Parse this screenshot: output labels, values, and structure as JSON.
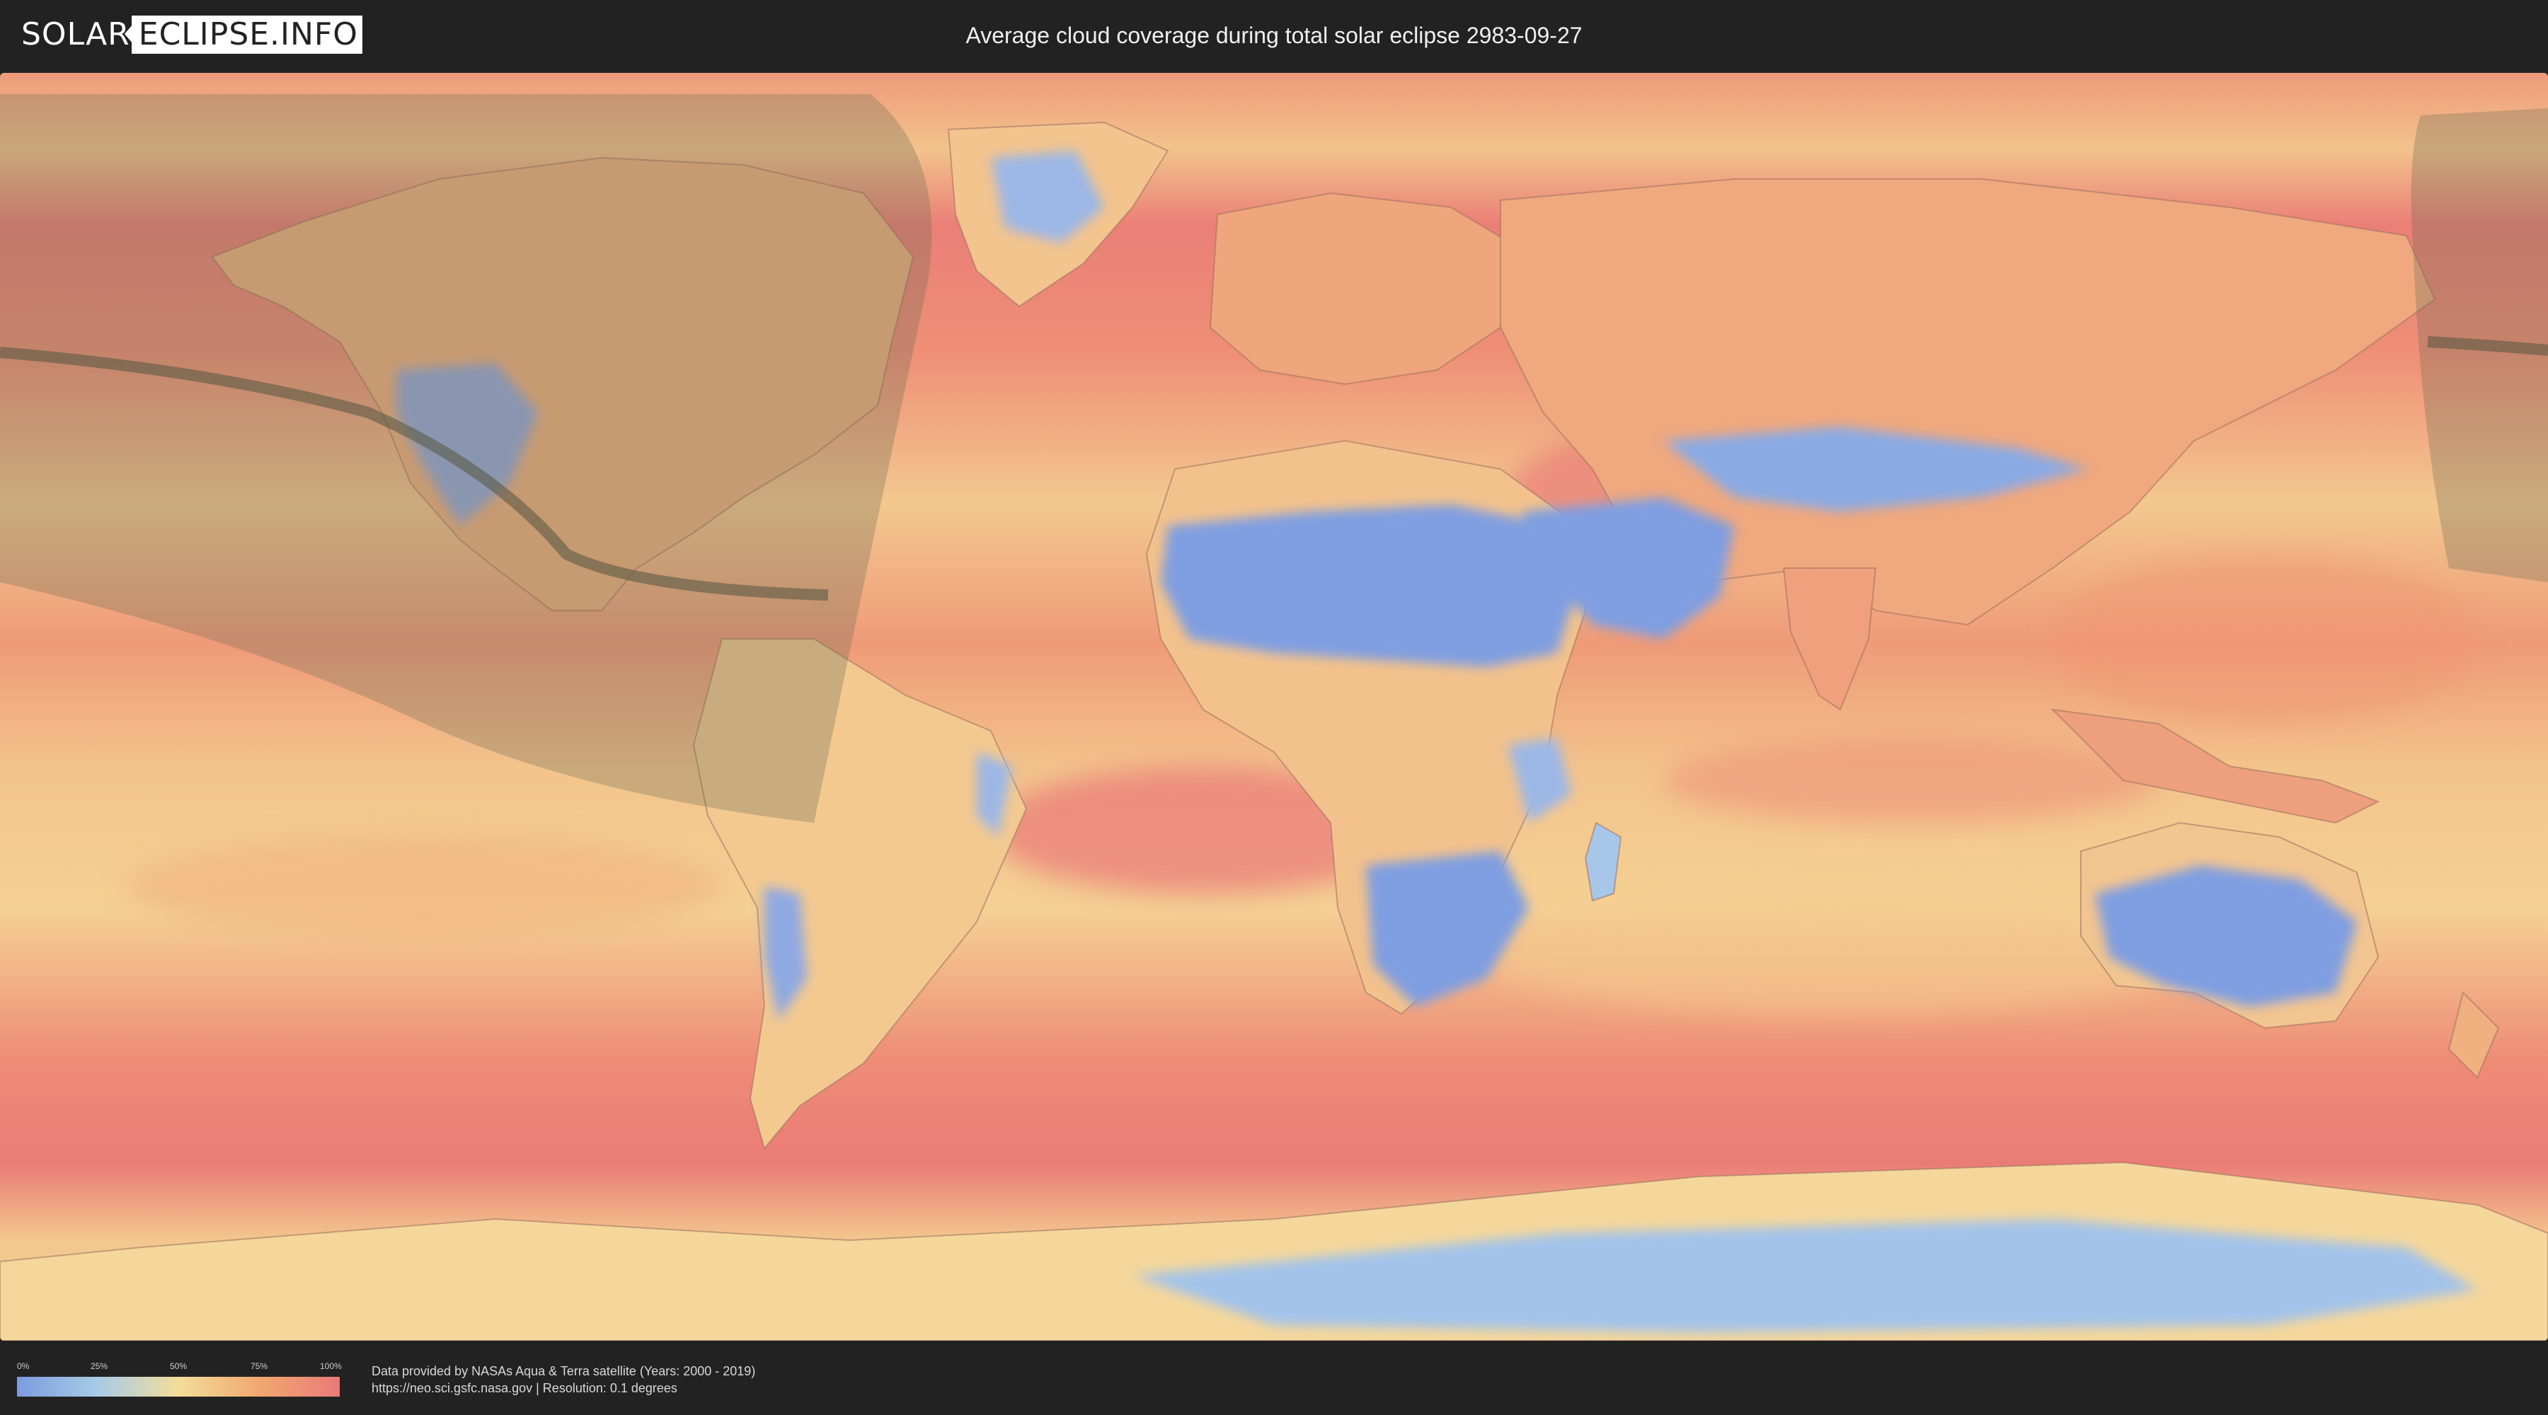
{
  "header": {
    "logo_left": "SOLAR",
    "logo_right": "ECLIPSE.INFO",
    "title": "Average cloud coverage during total solar eclipse 2983-09-27"
  },
  "map": {
    "colors": {
      "clear": "#7c9be0",
      "low": "#a8cbe6",
      "mid": "#f3dd9a",
      "high": "#f0a870",
      "overcast": "#ea7a78",
      "eclipse_band": "#6b6a52",
      "central_line": "#5b5a44"
    }
  },
  "legend": {
    "ticks": [
      "0%",
      "25%",
      "50%",
      "75%",
      "100%"
    ]
  },
  "footer": {
    "source_line": "Data provided by NASAs Aqua & Terra satellite (Years: 2000 - 2019)",
    "url_line": "https://neo.sci.gsfc.nasa.gov | Resolution: 0.1 degrees"
  }
}
